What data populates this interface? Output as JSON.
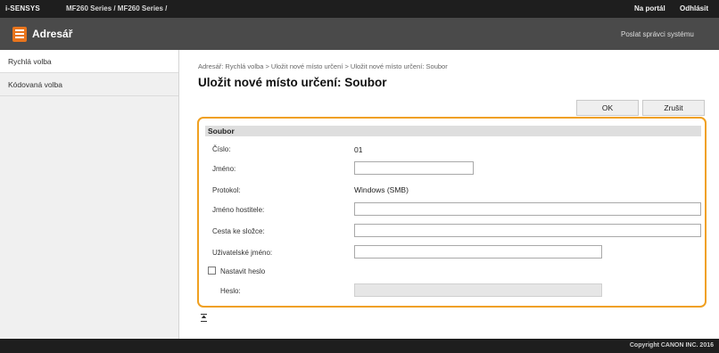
{
  "topbar": {
    "brand": "i-SENSYS",
    "model": "MF260 Series / MF260 Series /",
    "portal_link": "Na portál",
    "logout_link": "Odhlásit"
  },
  "appbar": {
    "icon": "address-book-icon",
    "title": "Adresář",
    "send_message": "Poslat správci systému"
  },
  "sidebar": {
    "items": [
      {
        "label": "Rychlá volba",
        "active": true
      },
      {
        "label": "Kódovaná volba",
        "active": false
      }
    ]
  },
  "breadcrumb": "Adresář: Rychlá volba > Uložit nové místo určení > Uložit nové místo určení: Soubor",
  "page_title": "Uložit nové místo určení: Soubor",
  "buttons": {
    "ok": "OK",
    "cancel": "Zrušit"
  },
  "form": {
    "section_title": "Soubor",
    "number_label": "Číslo:",
    "number_value": "01",
    "name_label": "Jméno:",
    "name_value": "",
    "protocol_label": "Protokol:",
    "protocol_value": "Windows (SMB)",
    "host_label": "Jméno hostitele:",
    "host_value": "",
    "folder_label": "Cesta ke složce:",
    "folder_value": "",
    "user_label": "Uživatelské jméno:",
    "user_value": "",
    "set_password_label": "Nastavit heslo",
    "set_password_checked": false,
    "password_label": "Heslo:",
    "password_value": ""
  },
  "footer": {
    "copyright": "Copyright CANON INC. 2016"
  },
  "colors": {
    "highlight": "#f0a020",
    "accent": "#e8741c",
    "topbar": "#1e1e1e",
    "appbar": "#4a4a4a"
  }
}
